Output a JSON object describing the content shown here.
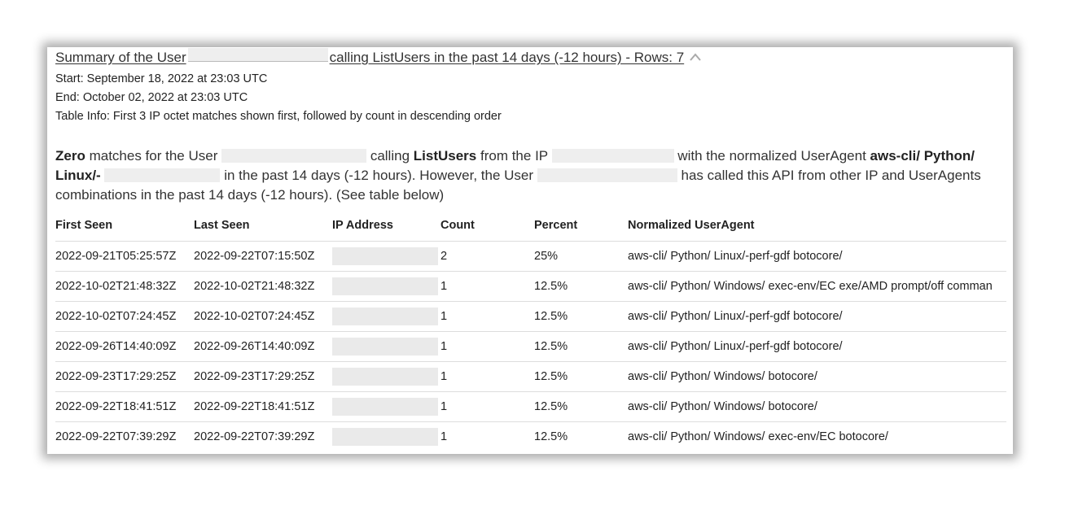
{
  "summary": {
    "prefix": "Summary of the User",
    "suffix": "calling ListUsers in the past 14 days (-12 hours) - Rows: 7"
  },
  "meta": {
    "start": "Start: September 18, 2022 at 23:03 UTC",
    "end": "End: October 02, 2022 at 23:03 UTC",
    "table_info": "Table Info: First 3 IP octet matches shown first, followed by count in descending order"
  },
  "paragraph": {
    "zero": "Zero",
    "t1": "matches for the User",
    "t2": "calling",
    "api": "ListUsers",
    "t3": "from the IP",
    "t4": "with the normalized UserAgent",
    "ua": "aws-cli/ Python/ Linux/-",
    "t5": "in the past 14 days (-12 hours). However, the User",
    "t6": "has called this API from other IP and UserAgents combinations in the past 14 days (-12 hours). (See table below)"
  },
  "table": {
    "headers": [
      "First Seen",
      "Last Seen",
      "IP Address",
      "Count",
      "Percent",
      "Normalized UserAgent"
    ],
    "rows": [
      [
        "2022-09-21T05:25:57Z",
        "2022-09-22T07:15:50Z",
        "",
        "2",
        "25%",
        "aws-cli/ Python/ Linux/-perf-gdf botocore/"
      ],
      [
        "2022-10-02T21:48:32Z",
        "2022-10-02T21:48:32Z",
        "",
        "1",
        "12.5%",
        "aws-cli/ Python/ Windows/ exec-env/EC exe/AMD prompt/off comman"
      ],
      [
        "2022-10-02T07:24:45Z",
        "2022-10-02T07:24:45Z",
        "",
        "1",
        "12.5%",
        "aws-cli/ Python/ Linux/-perf-gdf botocore/"
      ],
      [
        "2022-09-26T14:40:09Z",
        "2022-09-26T14:40:09Z",
        "",
        "1",
        "12.5%",
        "aws-cli/ Python/ Linux/-perf-gdf botocore/"
      ],
      [
        "2022-09-23T17:29:25Z",
        "2022-09-23T17:29:25Z",
        "",
        "1",
        "12.5%",
        "aws-cli/ Python/ Windows/ botocore/"
      ],
      [
        "2022-09-22T18:41:51Z",
        "2022-09-22T18:41:51Z",
        "",
        "1",
        "12.5%",
        "aws-cli/ Python/ Windows/ botocore/"
      ],
      [
        "2022-09-22T07:39:29Z",
        "2022-09-22T07:39:29Z",
        "",
        "1",
        "12.5%",
        "aws-cli/ Python/ Windows/ exec-env/EC botocore/"
      ]
    ]
  },
  "icons": {
    "collapse": "chevron-up-icon"
  },
  "colors": {
    "redaction": "#eeeeee",
    "divider": "#dddddd"
  }
}
